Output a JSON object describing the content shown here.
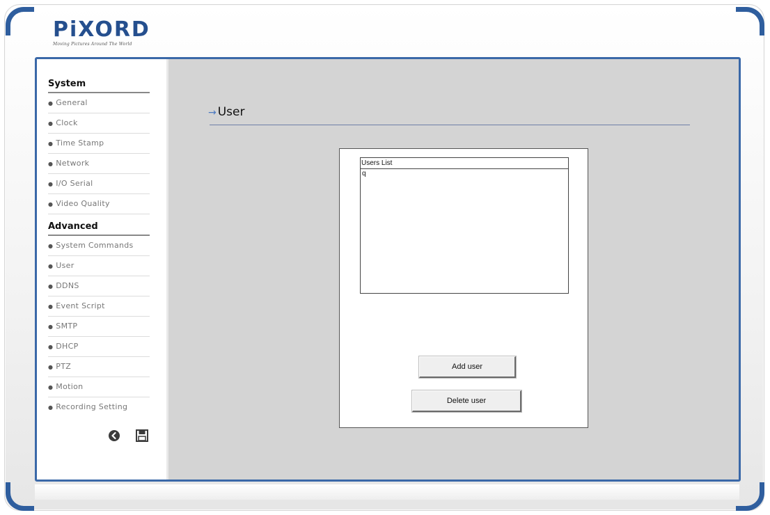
{
  "brand": {
    "logo_text": "PiXORD",
    "tagline": "Moving Pictures Around The World"
  },
  "sidebar": {
    "system_heading": "System",
    "system_items": [
      {
        "label": "General"
      },
      {
        "label": "Clock"
      },
      {
        "label": "Time Stamp"
      },
      {
        "label": "Network"
      },
      {
        "label": "I/O Serial"
      },
      {
        "label": "Video Quality"
      }
    ],
    "advanced_heading": "Advanced",
    "advanced_items": [
      {
        "label": "System Commands"
      },
      {
        "label": "User"
      },
      {
        "label": "DDNS"
      },
      {
        "label": "Event Script"
      },
      {
        "label": "SMTP"
      },
      {
        "label": "DHCP"
      },
      {
        "label": "PTZ"
      },
      {
        "label": "Motion"
      },
      {
        "label": "Recording Setting"
      }
    ],
    "tools": [
      {
        "icon": "back-circle-icon"
      },
      {
        "icon": "floppy-save-icon"
      }
    ]
  },
  "main": {
    "title": "User",
    "users_list": {
      "header": "Users List",
      "items": [
        "q"
      ]
    },
    "add_button": "Add user",
    "delete_button": "Delete user"
  },
  "colors": {
    "frame_blue": "#2f5e9e",
    "panel_border": "#3a68a8",
    "content_bg": "#d4d4d4",
    "title_arrow": "#4a78c0"
  }
}
